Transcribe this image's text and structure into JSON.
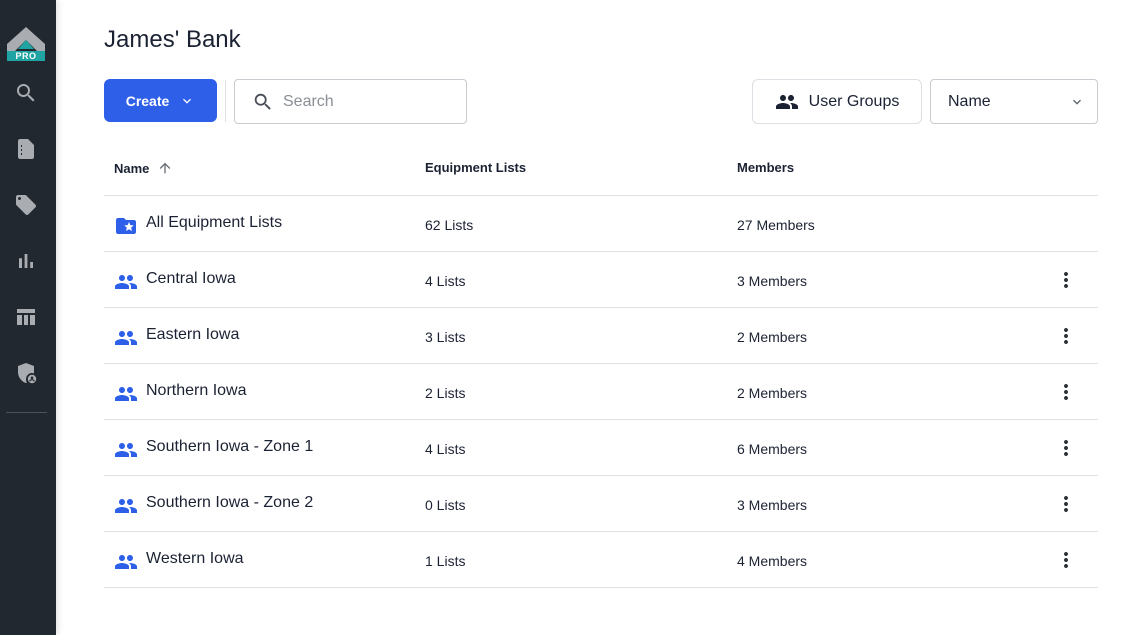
{
  "sidebar": {
    "logo_badge": "PRO",
    "items": [
      {
        "name": "search",
        "icon": "search-icon"
      },
      {
        "name": "documents",
        "icon": "document-icon"
      },
      {
        "name": "tags",
        "icon": "tag-icon"
      },
      {
        "name": "reports",
        "icon": "bar-chart-icon"
      },
      {
        "name": "tables",
        "icon": "table-icon"
      },
      {
        "name": "admin",
        "icon": "shield-user-icon"
      }
    ]
  },
  "header": {
    "title": "James' Bank"
  },
  "toolbar": {
    "create_label": "Create",
    "search_placeholder": "Search",
    "search_value": "",
    "user_groups_label": "User Groups",
    "sort_selected": "Name"
  },
  "table": {
    "columns": [
      {
        "label": "Name",
        "sort": "ascending"
      },
      {
        "label": "Equipment Lists"
      },
      {
        "label": "Members"
      }
    ],
    "rows": [
      {
        "icon": "folder-star-icon",
        "name": "All Equipment Lists",
        "lists": "62 Lists",
        "members": "27 Members",
        "has_menu": false
      },
      {
        "icon": "group-icon",
        "name": "Central Iowa",
        "lists": "4 Lists",
        "members": "3 Members",
        "has_menu": true
      },
      {
        "icon": "group-icon",
        "name": "Eastern Iowa",
        "lists": "3 Lists",
        "members": "2 Members",
        "has_menu": true
      },
      {
        "icon": "group-icon",
        "name": "Northern Iowa",
        "lists": "2 Lists",
        "members": "2 Members",
        "has_menu": true
      },
      {
        "icon": "group-icon",
        "name": "Southern Iowa - Zone 1",
        "lists": "4 Lists",
        "members": "6 Members",
        "has_menu": true
      },
      {
        "icon": "group-icon",
        "name": "Southern Iowa - Zone 2",
        "lists": "0 Lists",
        "members": "3 Members",
        "has_menu": true
      },
      {
        "icon": "group-icon",
        "name": "Western Iowa",
        "lists": "1 Lists",
        "members": "4 Members",
        "has_menu": true
      }
    ]
  },
  "colors": {
    "sidebar_bg": "#22282f",
    "accent": "#2d5fe8",
    "logo_teal": "#1fa3a3"
  }
}
